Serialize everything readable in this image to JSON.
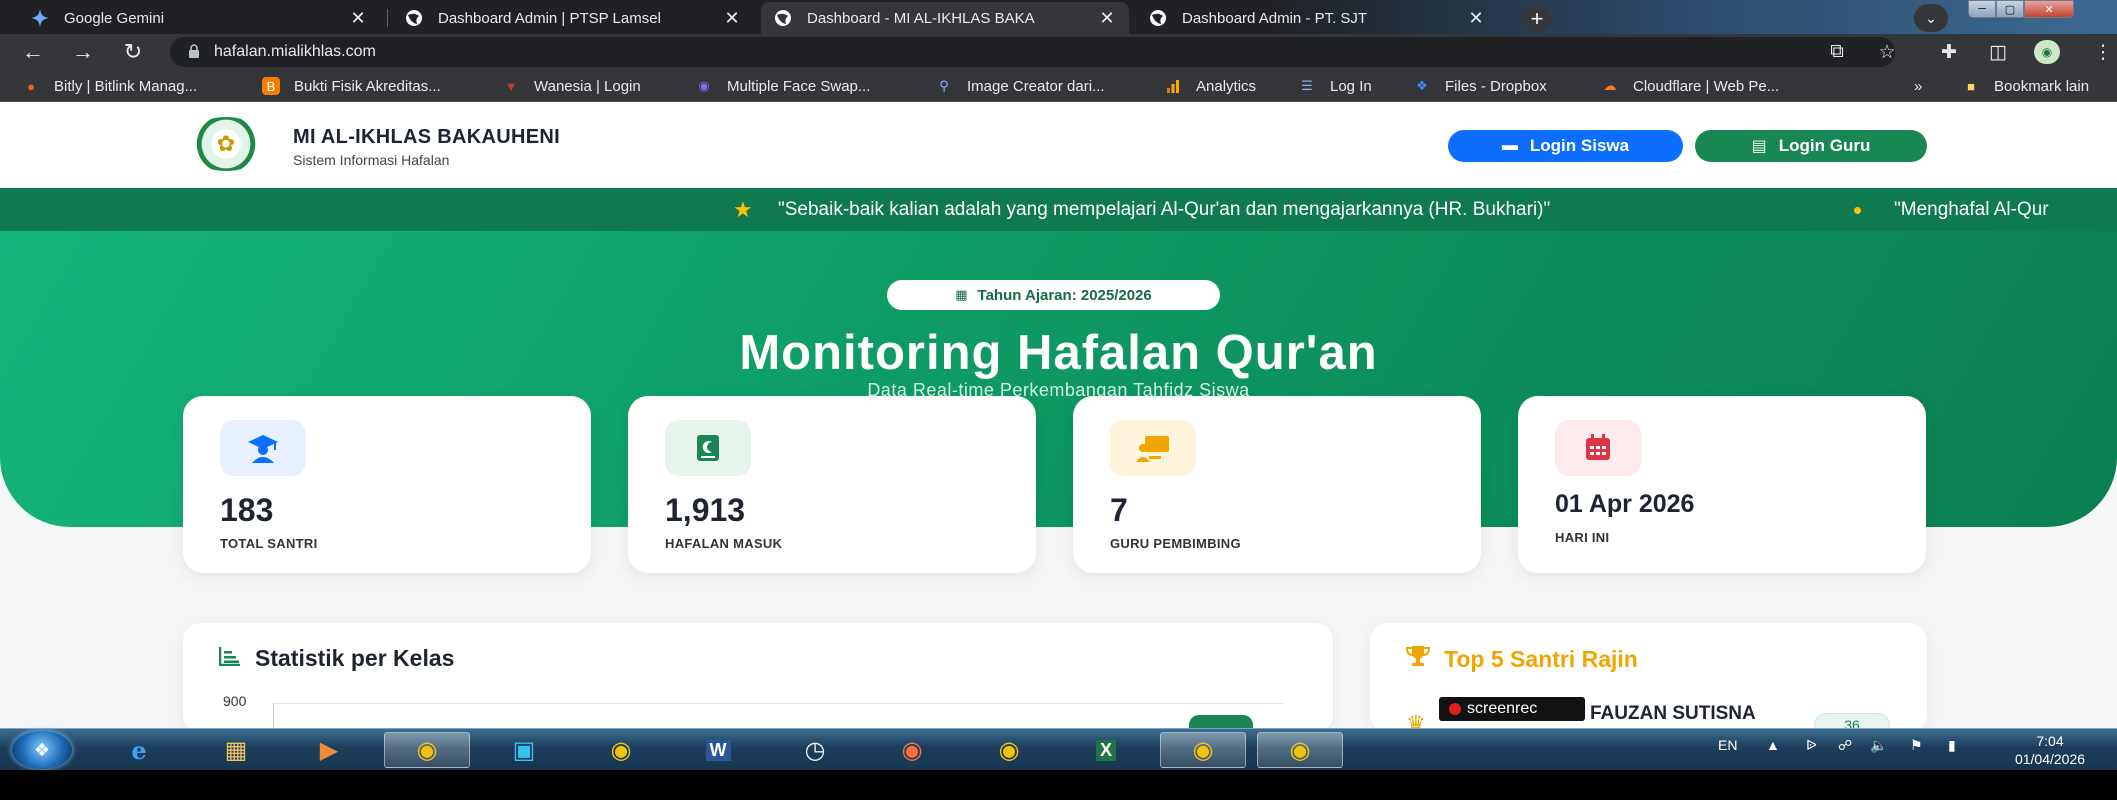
{
  "browser": {
    "tabs": [
      {
        "label": "Google Gemini",
        "icon": "gemini-icon",
        "active": false
      },
      {
        "label": "Dashboard Admin | PTSP Lamsel",
        "icon": "globe-icon",
        "active": false
      },
      {
        "label": "Dashboard - MI AL-IKHLAS BAKA",
        "icon": "globe-icon",
        "active": true
      },
      {
        "label": "Dashboard Admin - PT. SJT",
        "icon": "globe-icon",
        "active": false
      }
    ],
    "close_glyph": "✕",
    "new_tab_glyph": "+",
    "url": "hafalan.mialikhlas.com",
    "bookmarks": [
      {
        "label": "Bitly | Bitlink Manag...",
        "icon": "bitly-icon",
        "color": "#ee6123"
      },
      {
        "label": "Bukti Fisik Akreditas...",
        "icon": "blogger-icon",
        "color": "#f57d00"
      },
      {
        "label": "Wanesia | Login",
        "icon": "wanesia-icon",
        "color": "#c0392b"
      },
      {
        "label": "Multiple Face Swap...",
        "icon": "faceswap-icon",
        "color": "#6f42c1"
      },
      {
        "label": "Image Creator dari...",
        "icon": "search-icon",
        "color": "#1a73e8"
      },
      {
        "label": "Analytics",
        "icon": "analytics-icon",
        "color": "#f9ab00"
      },
      {
        "label": "Log In",
        "icon": "login-icon",
        "color": "#8ab4f8"
      },
      {
        "label": "Files - Dropbox",
        "icon": "dropbox-icon",
        "color": "#0061fe"
      },
      {
        "label": "Cloudflare | Web Pe...",
        "icon": "cloudflare-icon",
        "color": "#f38020"
      }
    ],
    "more_bookmarks": "»",
    "bookmark_folder": "Bookmark lain"
  },
  "site": {
    "school_name": "MI AL-IKHLAS BAKAUHENI",
    "school_subtitle": "Sistem Informasi Hafalan",
    "login_siswa": "Login Siswa",
    "login_guru": "Login Guru",
    "marquee_1": "\"Sebaik-baik kalian adalah yang mempelajari Al-Qur'an dan mengajarkannya (HR. Bukhari)\"",
    "marquee_2": "\"Menghafal Al-Qur",
    "academic_year": "Tahun Ajaran: 2025/2026",
    "hero_title": "Monitoring Hafalan Qur'an",
    "hero_subtitle": "Data Real-time Perkembangan Tahfidz Siswa",
    "stats": [
      {
        "value": "183",
        "label": "TOTAL SANTRI",
        "icon": "student-icon",
        "color": "#0d6efd",
        "bg": "#e7f0ff"
      },
      {
        "value": "1,913",
        "label": "HAFALAN MASUK",
        "icon": "quran-icon",
        "color": "#198754",
        "bg": "#e6f4ec"
      },
      {
        "value": "7",
        "label": "GURU PEMBIMBING",
        "icon": "teacher-icon",
        "color": "#f0a500",
        "bg": "#fff5dc"
      },
      {
        "value": "01 Apr 2026",
        "label": "HARI INI",
        "icon": "calendar-icon",
        "color": "#dc3545",
        "bg": "#fdeaec"
      }
    ],
    "stats_panel_title": "Statistik per Kelas",
    "chart_y_top": "900",
    "top_panel_title": "Top 5 Santri Rajin",
    "top_santri_name": "FAUZAN SUTISNA",
    "top_santri_count": "36",
    "screenrec_label": "screenrec"
  },
  "taskbar": {
    "apps": [
      {
        "icon": "ie-icon",
        "open": false
      },
      {
        "icon": "explorer-icon",
        "open": false
      },
      {
        "icon": "media-icon",
        "open": false
      },
      {
        "icon": "chrome-icon",
        "open": true
      },
      {
        "icon": "video-editor-icon",
        "open": false
      },
      {
        "icon": "chrome-icon",
        "open": false
      },
      {
        "icon": "word-icon",
        "open": false
      },
      {
        "icon": "clock-app-icon",
        "open": false
      },
      {
        "icon": "firefox-icon",
        "open": false
      },
      {
        "icon": "chrome-icon",
        "open": false
      },
      {
        "icon": "excel-icon",
        "open": false
      },
      {
        "icon": "chrome-icon",
        "open": true
      },
      {
        "icon": "chrome-icon",
        "open": true
      }
    ],
    "lang": "EN",
    "time": "7:04",
    "date": "01/04/2026"
  }
}
